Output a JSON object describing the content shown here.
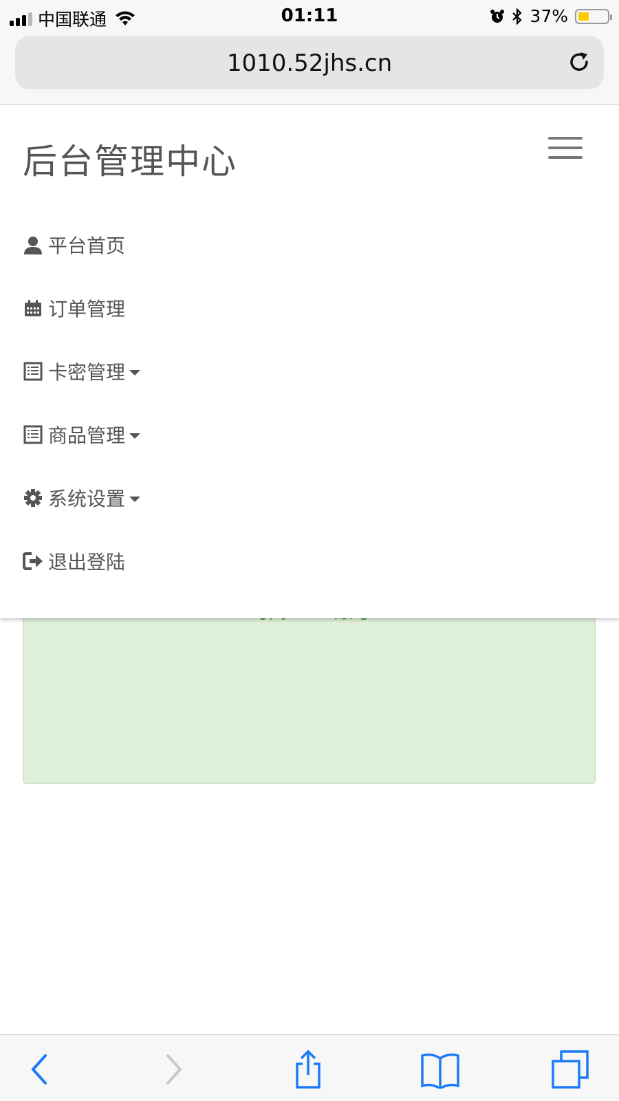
{
  "status_bar": {
    "carrier": "中国联通",
    "time": "01:11",
    "battery": "37%",
    "battery_color": "#ffcc00"
  },
  "url_bar": {
    "url": "1010.52jhs.cn"
  },
  "navbar": {
    "brand": "后台管理中心",
    "menu_items": [
      {
        "label": "平台首页",
        "icon": "user-icon"
      },
      {
        "label": "订单管理",
        "icon": "calendar-icon"
      },
      {
        "label": "卡密管理",
        "icon": "list-icon",
        "dropdown": true
      },
      {
        "label": "商品管理",
        "icon": "list-icon",
        "dropdown": true
      },
      {
        "label": "系统设置",
        "icon": "gear-icon",
        "dropdown": true
      },
      {
        "label": "退出登陆",
        "icon": "sign-out-icon"
      }
    ]
  },
  "content": {
    "header_partial": [
      "时间",
      "账号"
    ],
    "alert_color": "#dff0d8"
  },
  "toolbar": {
    "accent": "#1a7cf5",
    "buttons": [
      "back-icon",
      "forward-icon",
      "share-icon",
      "bookmarks-icon",
      "tabs-icon"
    ]
  }
}
